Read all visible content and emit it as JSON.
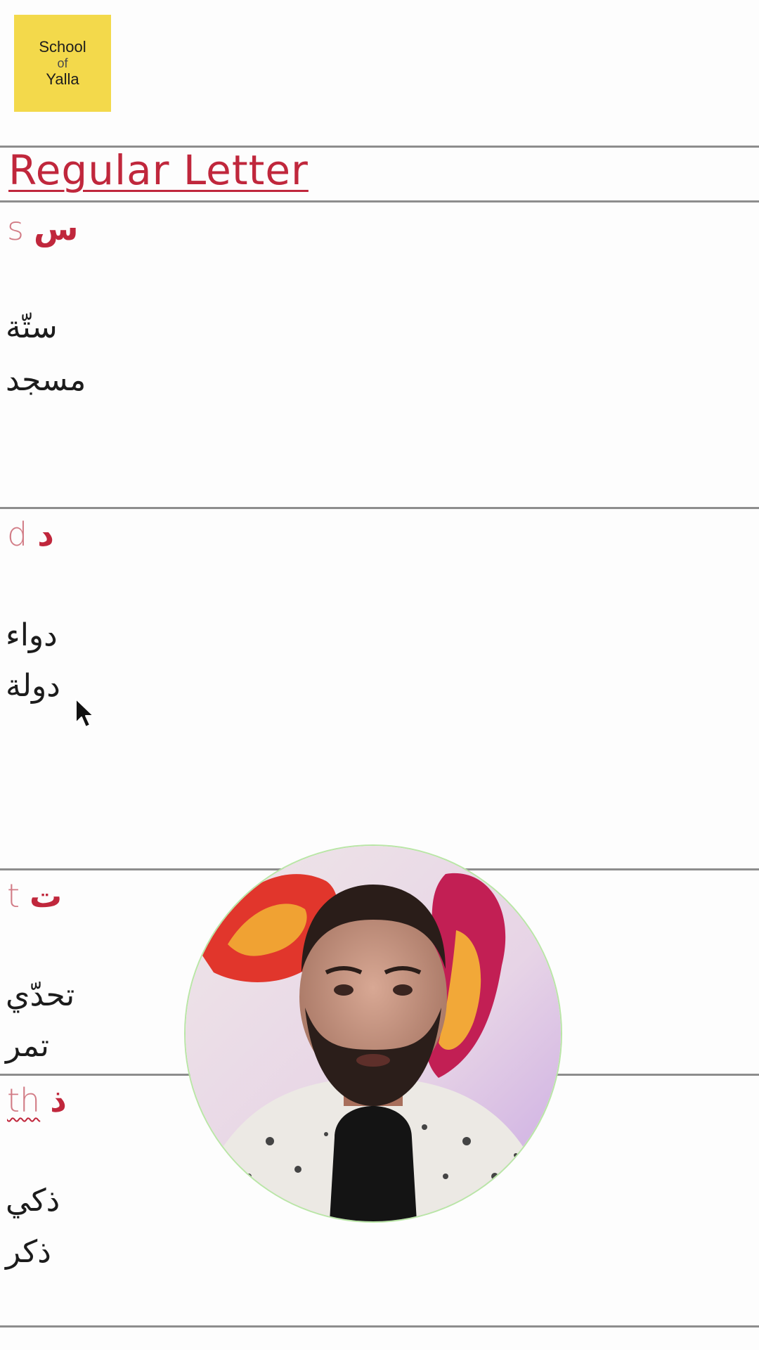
{
  "logo": {
    "line1": "School",
    "line2": "of",
    "line3": "Yalla",
    "color": "#f3d94b"
  },
  "section": {
    "title": "Regular Letter"
  },
  "letters": [
    {
      "latin": "s",
      "arabic": "س",
      "words": [
        "ستّة",
        "مسجد"
      ]
    },
    {
      "latin": "d",
      "arabic": "د",
      "words": [
        "دواء",
        "دولة"
      ]
    },
    {
      "latin": "t",
      "arabic": "ت",
      "words": [
        "تحدّي",
        "تمر"
      ]
    },
    {
      "latin": "th",
      "arabic": "ذ",
      "words": [
        "ذكي",
        "ذكر"
      ]
    }
  ],
  "colors": {
    "accent": "#c0273c",
    "latin": "#d27c86",
    "rule": "#8d8d8d"
  },
  "icons": {
    "cursor": "mouse-pointer-icon",
    "webcam": "presenter-webcam"
  }
}
